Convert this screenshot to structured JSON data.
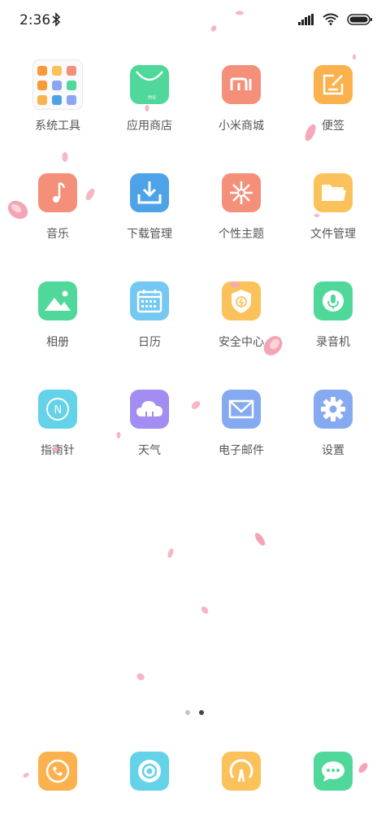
{
  "status_bar": {
    "time": "2:36"
  },
  "apps": [
    {
      "label": "系统工具",
      "icon": "folder-icon"
    },
    {
      "label": "应用商店",
      "icon": "shopping-bag-icon",
      "color": "#4fd89a"
    },
    {
      "label": "小米商城",
      "icon": "mi-logo-icon",
      "color": "#f4907a"
    },
    {
      "label": "便签",
      "icon": "note-edit-icon",
      "color": "#fbb24e"
    },
    {
      "label": "音乐",
      "icon": "music-note-icon",
      "color": "#f4907a"
    },
    {
      "label": "下载管理",
      "icon": "download-tray-icon",
      "color": "#4ea3e8"
    },
    {
      "label": "个性主题",
      "icon": "theme-flower-icon",
      "color": "#f4907a"
    },
    {
      "label": "文件管理",
      "icon": "folder-open-icon",
      "color": "#fbc15a"
    },
    {
      "label": "相册",
      "icon": "mountain-photo-icon",
      "color": "#4fd89a"
    },
    {
      "label": "日历",
      "icon": "calendar-icon",
      "color": "#74c8f4"
    },
    {
      "label": "安全中心",
      "icon": "shield-bolt-icon",
      "color": "#fbc15a"
    },
    {
      "label": "录音机",
      "icon": "microphone-icon",
      "color": "#4fd89a"
    },
    {
      "label": "指南针",
      "icon": "compass-icon",
      "color": "#64d2e8"
    },
    {
      "label": "天气",
      "icon": "cloud-icon",
      "color": "#a38df2"
    },
    {
      "label": "电子邮件",
      "icon": "envelope-icon",
      "color": "#86aaf2"
    },
    {
      "label": "设置",
      "icon": "gear-icon",
      "color": "#86aaf2"
    }
  ],
  "dock": [
    {
      "icon": "phone-icon",
      "color": "#fbb24e"
    },
    {
      "icon": "camera-lens-icon",
      "color": "#64d2e8"
    },
    {
      "icon": "browser-icon",
      "color": "#fbc15a"
    },
    {
      "icon": "message-bubble-icon",
      "color": "#4fd89a"
    }
  ],
  "pager": {
    "pages": 2,
    "current": 2
  }
}
